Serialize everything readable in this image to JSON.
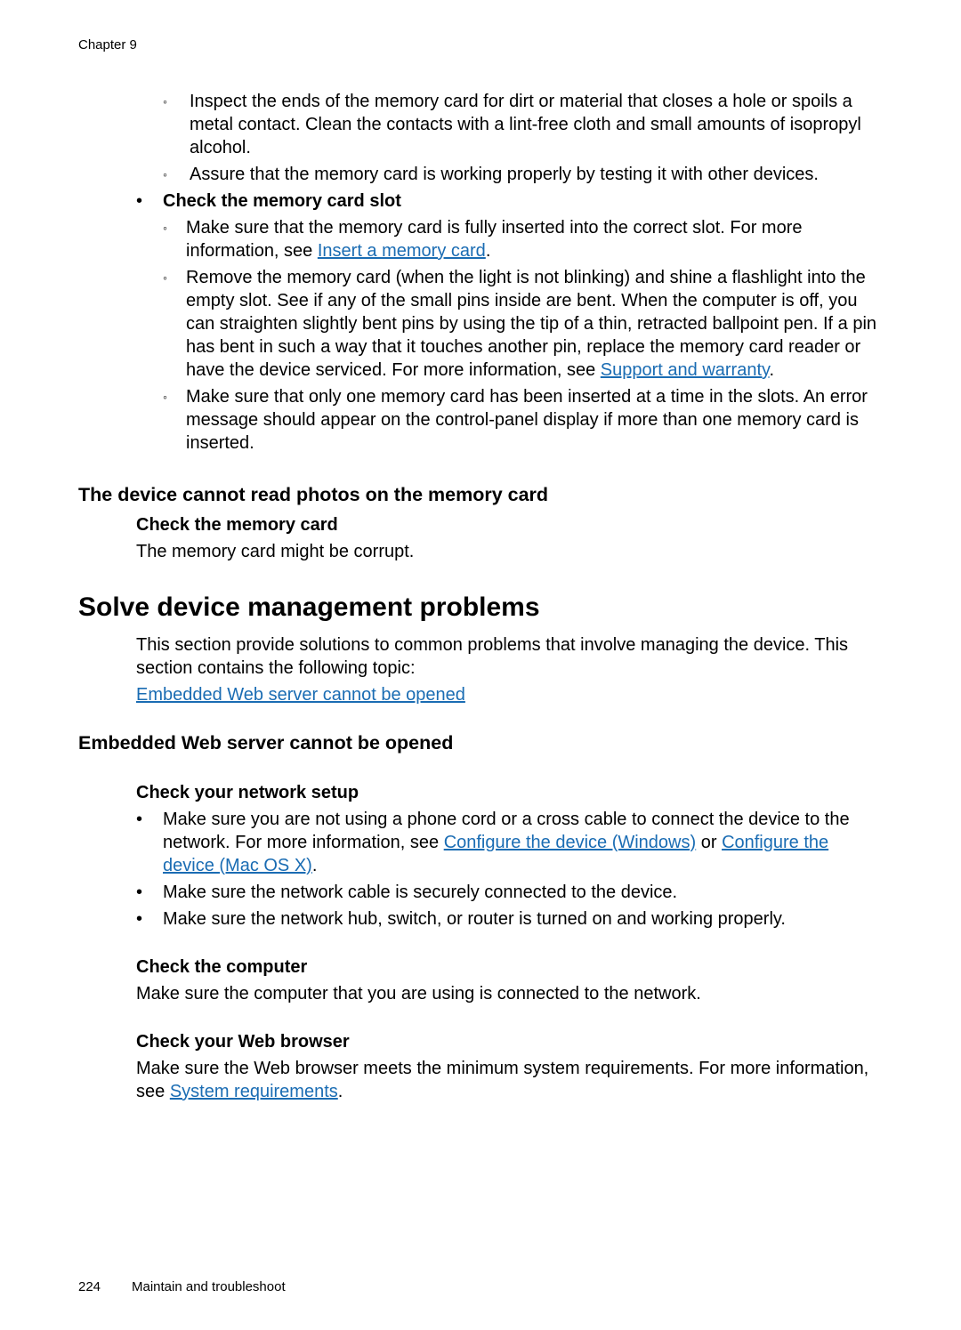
{
  "chapter": "Chapter 9",
  "top_sub_bullets": [
    "Inspect the ends of the memory card for dirt or material that closes a hole or spoils a metal contact. Clean the contacts with a lint-free cloth and small amounts of isopropyl alcohol.",
    "Assure that the memory card is working properly by testing it with other devices."
  ],
  "check_slot_label": "Check the memory card slot",
  "slot_b1_pre": "Make sure that the memory card is fully inserted into the correct slot. For more information, see ",
  "slot_b1_link": "Insert a memory card",
  "period": ".",
  "slot_b2_pre": "Remove the memory card (when the light is not blinking) and shine a flashlight into the empty slot. See if any of the small pins inside are bent. When the computer is off, you can straighten slightly bent pins by using the tip of a thin, retracted ballpoint pen. If a pin has bent in such a way that it touches another pin, replace the memory card reader or have the device serviced. For more information, see ",
  "slot_b2_link": "Support and warranty",
  "slot_b3": "Make sure that only one memory card has been inserted at a time in the slots. An error message should appear on the control-panel display if more than one memory card is inserted.",
  "h3_cannot_read": "The device cannot read photos on the memory card",
  "h4_check_card": "Check the memory card",
  "corrupt_text": "The memory card might be corrupt.",
  "h1_solve": "Solve device management problems",
  "solve_para": "This section provide solutions to common problems that involve managing the device. This section contains the following topic:",
  "ews_link": "Embedded Web server cannot be opened",
  "h3_ews": "Embedded Web server cannot be opened",
  "h4_net": "Check your network setup",
  "net_b1_pre": "Make sure you are not using a phone cord or a cross cable to connect the device to the network. For more information, see ",
  "net_b1_link1": "Configure the device (Windows)",
  "net_b1_mid": " or ",
  "net_b1_link2": "Configure the device (Mac OS X)",
  "net_b2": "Make sure the network cable is securely connected to the device.",
  "net_b3": "Make sure the network hub, switch, or router is turned on and working properly.",
  "h4_comp": "Check the computer",
  "comp_text": "Make sure the computer that you are using is connected to the network.",
  "h4_browser": "Check your Web browser",
  "browser_pre": "Make sure the Web browser meets the minimum system requirements. For more information, see ",
  "browser_link": "System requirements",
  "page_num": "224",
  "footer_text": "Maintain and troubleshoot"
}
